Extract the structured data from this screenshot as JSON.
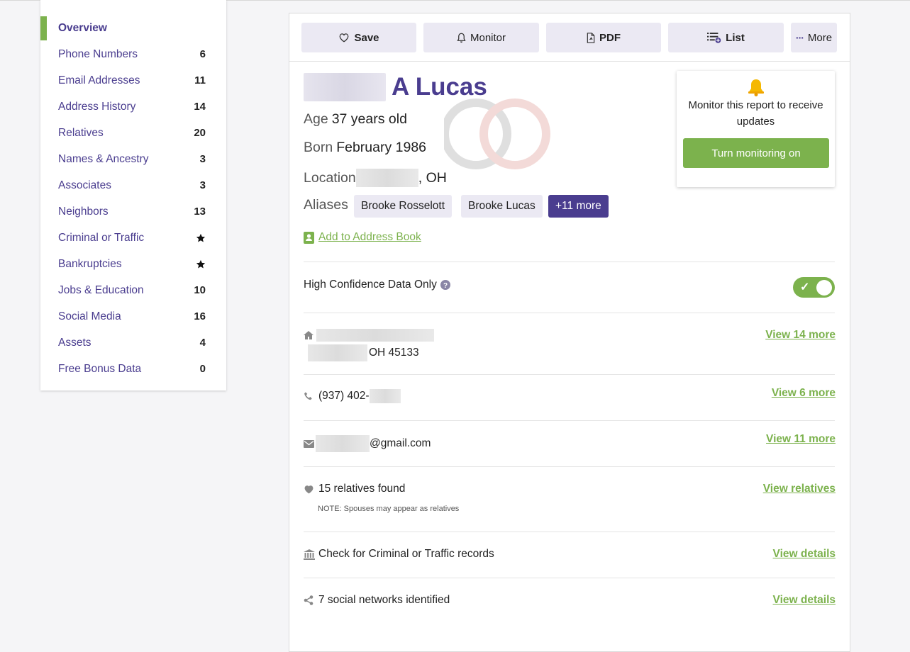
{
  "sidebar": {
    "items": [
      {
        "label": "Overview",
        "count": ""
      },
      {
        "label": "Phone Numbers",
        "count": "6"
      },
      {
        "label": "Email Addresses",
        "count": "11"
      },
      {
        "label": "Address History",
        "count": "14"
      },
      {
        "label": "Relatives",
        "count": "20"
      },
      {
        "label": "Names & Ancestry",
        "count": "3"
      },
      {
        "label": "Associates",
        "count": "3"
      },
      {
        "label": "Neighbors",
        "count": "13"
      },
      {
        "label": "Criminal or Traffic",
        "count": "",
        "icon": "star-icon"
      },
      {
        "label": "Bankruptcies",
        "count": "",
        "icon": "star-icon"
      },
      {
        "label": "Jobs & Education",
        "count": "10"
      },
      {
        "label": "Social Media",
        "count": "16"
      },
      {
        "label": "Assets",
        "count": "4"
      },
      {
        "label": "Free Bonus Data",
        "count": "0"
      }
    ]
  },
  "toolbar": {
    "save": "Save",
    "monitor": "Monitor",
    "pdf": "PDF",
    "list": "List",
    "more": "More"
  },
  "person": {
    "last_name": "A Lucas",
    "age_key": "Age",
    "age_value": "37 years old",
    "born_key": "Born",
    "born_value": "February 1986",
    "location_key": "Location",
    "location_value": ", OH",
    "aliases_key": "Aliases",
    "aliases": [
      "Brooke Rosselott",
      "Brooke Lucas"
    ],
    "aliases_more": "+11 more",
    "add_to_address_book": "Add to Address Book"
  },
  "high_confidence": {
    "label": "High Confidence Data Only",
    "toggle_on": true
  },
  "rows": {
    "address_line2": "OH 45133",
    "address_link": "View 14 more",
    "phone": "(937) 402-",
    "phone_link": "View 6 more",
    "email": "@gmail.com",
    "email_link": "View 11 more",
    "relatives": "15 relatives found",
    "relatives_note": "NOTE: Spouses may appear as relatives",
    "relatives_link": "View relatives",
    "criminal": "Check for Criminal or Traffic records",
    "criminal_link": "View details",
    "social": "7 social networks identified",
    "social_link": "View details"
  },
  "monitor_popup": {
    "message": "Monitor this report to receive updates",
    "button": "Turn monitoring on"
  },
  "colors": {
    "brand_purple": "#4a3d8f",
    "accent_green": "#7cb24d",
    "button_bg": "#ebe9f3"
  }
}
